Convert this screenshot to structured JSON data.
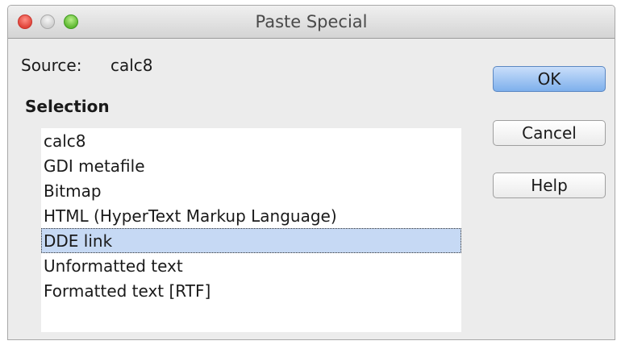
{
  "window": {
    "title": "Paste Special"
  },
  "source": {
    "label": "Source:",
    "value": "calc8"
  },
  "selection": {
    "heading": "Selection",
    "items": [
      {
        "label": "calc8"
      },
      {
        "label": "GDI metafile"
      },
      {
        "label": "Bitmap"
      },
      {
        "label": "HTML (HyperText Markup Language)"
      },
      {
        "label": "DDE link",
        "selected": true
      },
      {
        "label": "Unformatted text"
      },
      {
        "label": "Formatted text [RTF]"
      }
    ]
  },
  "buttons": {
    "ok": "OK",
    "cancel": "Cancel",
    "help": "Help"
  },
  "colors": {
    "selection_highlight": "#c6d9f4",
    "default_button": "#7eb0ec",
    "close": "#e0443a",
    "maximize": "#5fb832"
  }
}
